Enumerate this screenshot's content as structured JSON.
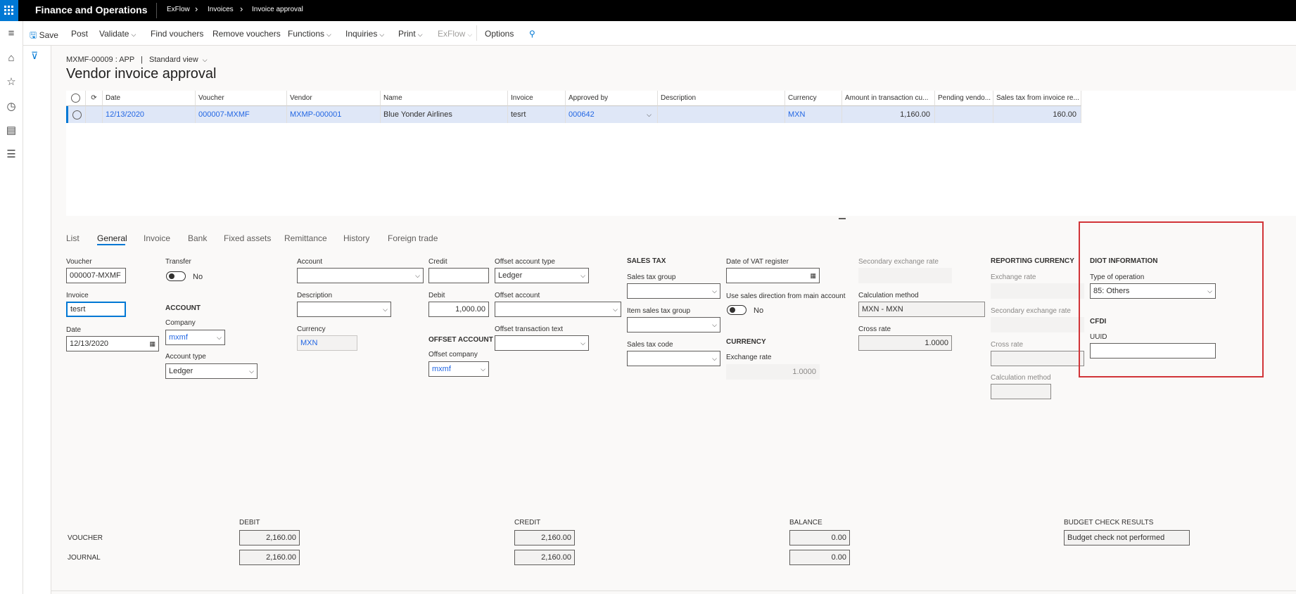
{
  "topbar": {
    "app_title": "Finance and Operations",
    "breadcrumbs": [
      "ExFlow",
      "Invoices",
      "Invoice approval"
    ]
  },
  "actions": {
    "save": "Save",
    "post": "Post",
    "validate": "Validate",
    "find_vouchers": "Find vouchers",
    "remove_vouchers": "Remove vouchers",
    "functions": "Functions",
    "inquiries": "Inquiries",
    "print": "Print",
    "exflow": "ExFlow",
    "options": "Options"
  },
  "header": {
    "record": "MXMF-00009 : APP",
    "view": "Standard view",
    "title": "Vendor invoice approval"
  },
  "grid": {
    "columns": [
      "Date",
      "Voucher",
      "Vendor",
      "Name",
      "Invoice",
      "Approved by",
      "Description",
      "Currency",
      "Amount in transaction cu...",
      "Pending vendo...",
      "Sales tax from invoice re..."
    ],
    "rows": [
      {
        "date": "12/13/2020",
        "voucher": "000007-MXMF",
        "vendor": "MXMP-000001",
        "name": "Blue Yonder Airlines",
        "invoice": "tesrt",
        "approved_by": "000642",
        "description": "",
        "currency": "MXN",
        "amount": "1,160.00",
        "pending": "",
        "sales_tax": "160.00"
      }
    ]
  },
  "tabs": [
    "List",
    "General",
    "Invoice",
    "Bank",
    "Fixed assets",
    "Remittance",
    "History",
    "Foreign trade"
  ],
  "form": {
    "voucher_label": "Voucher",
    "voucher_value": "000007-MXMF",
    "invoice_label": "Invoice",
    "invoice_value": "tesrt",
    "date_label": "Date",
    "date_value": "12/13/2020",
    "transfer_label": "Transfer",
    "transfer_value": "No",
    "account_section": "ACCOUNT",
    "company_label": "Company",
    "company_value": "mxmf",
    "account_type_label": "Account type",
    "account_type_value": "Ledger",
    "account_label": "Account",
    "description_label": "Description",
    "currency_label": "Currency",
    "currency_value": "MXN",
    "credit_label": "Credit",
    "debit_label": "Debit",
    "debit_value": "1,000.00",
    "offset_account_section": "OFFSET ACCOUNT",
    "offset_company_label": "Offset company",
    "offset_company_value": "mxmf",
    "offset_account_type_label": "Offset account type",
    "offset_account_type_value": "Ledger",
    "offset_account_label": "Offset account",
    "offset_transaction_text_label": "Offset transaction text",
    "sales_tax_section": "SALES TAX",
    "sales_tax_group_label": "Sales tax group",
    "item_sales_tax_group_label": "Item sales tax group",
    "sales_tax_code_label": "Sales tax code",
    "date_vat_label": "Date of VAT register",
    "use_sales_direction_label": "Use sales direction from main account",
    "use_sales_direction_value": "No",
    "currency_section": "CURRENCY",
    "exchange_rate_label": "Exchange rate",
    "exchange_rate_value": "1.0000",
    "secondary_exchange_rate_label": "Secondary exchange rate",
    "calculation_method_label": "Calculation method",
    "calculation_method_value": "MXN - MXN",
    "cross_rate_label": "Cross rate",
    "cross_rate_value": "1.0000",
    "reporting_currency_section": "REPORTING CURRENCY",
    "rc_exchange_rate_label": "Exchange rate",
    "rc_secondary_exchange_rate_label": "Secondary exchange rate",
    "rc_cross_rate_label": "Cross rate",
    "rc_calculation_method_label": "Calculation method",
    "diot_section": "DIOT INFORMATION",
    "type_of_operation_label": "Type of operation",
    "type_of_operation_value": "85: Others",
    "cfdi_section": "CFDI",
    "uuid_label": "UUID"
  },
  "totals": {
    "debit_header": "DEBIT",
    "credit_header": "CREDIT",
    "balance_header": "BALANCE",
    "budget_header": "BUDGET CHECK RESULTS",
    "voucher_label": "VOUCHER",
    "journal_label": "JOURNAL",
    "voucher_debit": "2,160.00",
    "voucher_credit": "2,160.00",
    "voucher_balance": "0.00",
    "journal_debit": "2,160.00",
    "journal_credit": "2,160.00",
    "journal_balance": "0.00",
    "budget_result": "Budget check not performed"
  },
  "colors": {
    "accent": "#0078d4",
    "link": "#2266e3",
    "highlight_box": "#d13438",
    "selected_row": "#dfe7f7"
  }
}
